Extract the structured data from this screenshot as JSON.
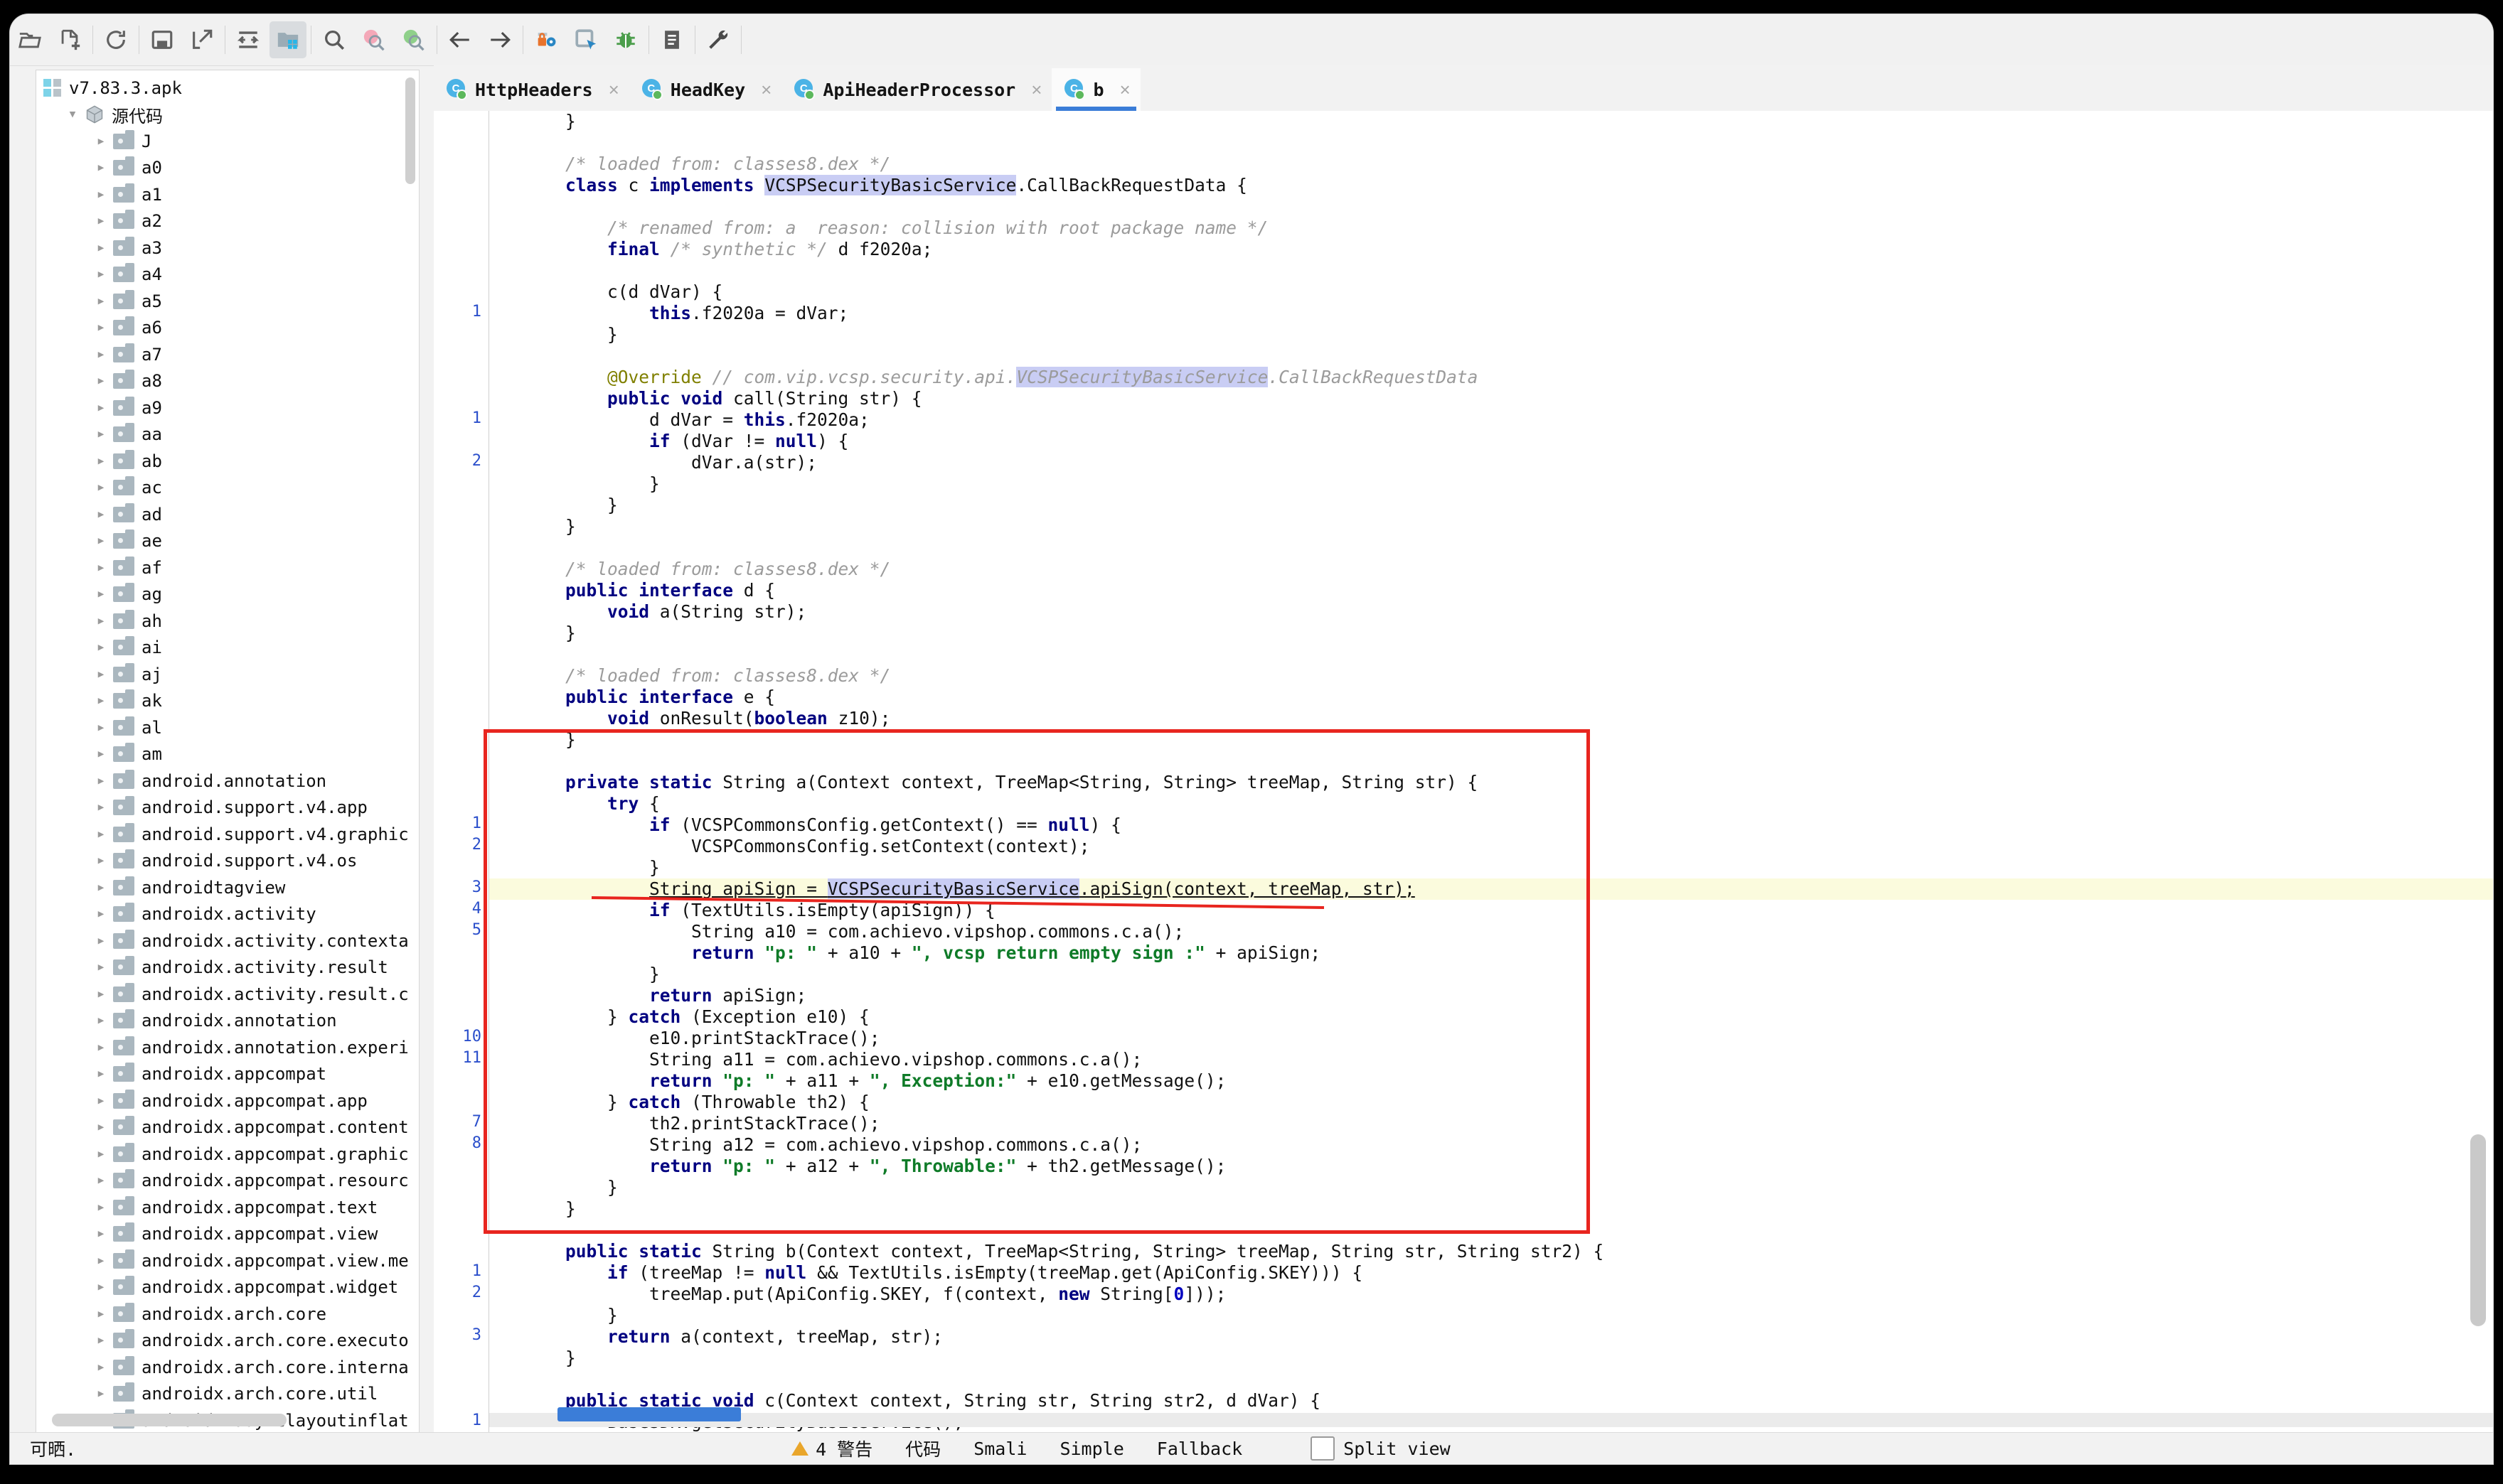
{
  "window": {
    "title": "v7.83.3.apk"
  },
  "toolbar": {
    "buttons": [
      {
        "name": "open-folder-icon",
        "label": "打开"
      },
      {
        "name": "add-file-icon",
        "label": "添加"
      },
      {
        "name": "refresh-icon",
        "label": "刷新"
      },
      {
        "name": "save-icon",
        "label": "保存"
      },
      {
        "name": "export-icon",
        "label": "导出"
      },
      {
        "name": "collapse-icon",
        "label": "折叠"
      },
      {
        "name": "folder-grid-icon",
        "label": "资源"
      },
      {
        "name": "search-icon",
        "label": "搜索"
      },
      {
        "name": "search-prev-icon",
        "label": "上一个"
      },
      {
        "name": "search-next-icon",
        "label": "下一个"
      },
      {
        "name": "back-arrow-icon",
        "label": "后退"
      },
      {
        "name": "forward-arrow-icon",
        "label": "前进"
      },
      {
        "name": "lock-gear-icon",
        "label": "签名"
      },
      {
        "name": "window-pointer-icon",
        "label": "窗口"
      },
      {
        "name": "bug-icon",
        "label": "调试"
      },
      {
        "name": "log-icon",
        "label": "日志"
      },
      {
        "name": "wrench-icon",
        "label": "工具"
      }
    ]
  },
  "tabs": [
    {
      "label": "HttpHeaders",
      "icon": "java-class-icon",
      "close": "×",
      "selected": false
    },
    {
      "label": "HeadKey",
      "icon": "java-class-icon",
      "close": "×",
      "selected": false
    },
    {
      "label": "ApiHeaderProcessor",
      "icon": "java-class-icon",
      "close": "×",
      "selected": false
    },
    {
      "label": "b",
      "icon": "java-class-icon",
      "close": "×",
      "selected": true
    }
  ],
  "sidebar": {
    "root": {
      "label": "v7.83.3.apk",
      "icon": "apk-icon"
    },
    "source_node": {
      "label": "源代码",
      "icon": "package-cube-icon",
      "expanded": true
    },
    "items": [
      "J",
      "a0",
      "a1",
      "a2",
      "a3",
      "a4",
      "a5",
      "a6",
      "a7",
      "a8",
      "a9",
      "aa",
      "ab",
      "ac",
      "ad",
      "ae",
      "af",
      "ag",
      "ah",
      "ai",
      "aj",
      "ak",
      "al",
      "am",
      "android.annotation",
      "android.support.v4.app",
      "android.support.v4.graphic",
      "android.support.v4.os",
      "androidtagview",
      "androidx.activity",
      "androidx.activity.contexta",
      "androidx.activity.result",
      "androidx.activity.result.c",
      "androidx.annotation",
      "androidx.annotation.experi",
      "androidx.appcompat",
      "androidx.appcompat.app",
      "androidx.appcompat.content",
      "androidx.appcompat.graphic",
      "androidx.appcompat.resourc",
      "androidx.appcompat.text",
      "androidx.appcompat.view",
      "androidx.appcompat.view.me",
      "androidx.appcompat.widget",
      "androidx.arch.core",
      "androidx.arch.core.executo",
      "androidx.arch.core.interna",
      "androidx.arch.core.util",
      "androidx.asynclayoutinflat"
    ]
  },
  "editor": {
    "lines": [
      {
        "gutter": "",
        "html": "    }"
      },
      {
        "gutter": "",
        "html": ""
      },
      {
        "gutter": "",
        "html": "    <span class='cm'>/* loaded from: classes8.dex */</span>"
      },
      {
        "gutter": "",
        "html": "    <span class='kw'>class</span> c <span class='kw'>implements</span> <span class='sel'>VCSPSecurityBasicService</span>.CallBackRequestData {"
      },
      {
        "gutter": "",
        "html": ""
      },
      {
        "gutter": "",
        "html": "        <span class='cm'>/* renamed from: a  reason: collision with root package name */</span>"
      },
      {
        "gutter": "",
        "html": "        <span class='kw'>final</span> <span class='cm'>/* synthetic */</span> d f2020a;"
      },
      {
        "gutter": "",
        "html": ""
      },
      {
        "gutter": "",
        "html": "        c(d dVar) {"
      },
      {
        "gutter": "1",
        "html": "            <span class='kw'>this</span>.f2020a = dVar;"
      },
      {
        "gutter": "",
        "html": "        }"
      },
      {
        "gutter": "",
        "html": ""
      },
      {
        "gutter": "",
        "html": "        <span class='an'>@Override</span> <span class='cm'>// com.vip.vcsp.security.api.</span><span class='sel cm'>VCSPSecurityBasicService</span><span class='cm'>.CallBackRequestData</span>"
      },
      {
        "gutter": "",
        "html": "        <span class='kw'>public void</span> call(String str) {"
      },
      {
        "gutter": "1",
        "html": "            d dVar = <span class='kw'>this</span>.f2020a;"
      },
      {
        "gutter": "",
        "html": "            <span class='kw'>if</span> (dVar != <span class='kw'>null</span>) {"
      },
      {
        "gutter": "2",
        "html": "                dVar.a(str);"
      },
      {
        "gutter": "",
        "html": "            }"
      },
      {
        "gutter": "",
        "html": "        }"
      },
      {
        "gutter": "",
        "html": "    }"
      },
      {
        "gutter": "",
        "html": ""
      },
      {
        "gutter": "",
        "html": "    <span class='cm'>/* loaded from: classes8.dex */</span>"
      },
      {
        "gutter": "",
        "html": "    <span class='kw'>public interface</span> d {"
      },
      {
        "gutter": "",
        "html": "        <span class='kw'>void</span> a(String str);"
      },
      {
        "gutter": "",
        "html": "    }"
      },
      {
        "gutter": "",
        "html": ""
      },
      {
        "gutter": "",
        "html": "    <span class='cm'>/* loaded from: classes8.dex */</span>"
      },
      {
        "gutter": "",
        "html": "    <span class='kw'>public interface</span> e {"
      },
      {
        "gutter": "",
        "html": "        <span class='kw'>void</span> onResult(<span class='kw'>boolean</span> z10);"
      },
      {
        "gutter": "",
        "html": "    }"
      },
      {
        "gutter": "",
        "html": ""
      },
      {
        "gutter": "",
        "html": "    <span class='kw'>private static</span> String a(Context context, TreeMap&lt;String, String&gt; treeMap, String str) {"
      },
      {
        "gutter": "",
        "html": "        <span class='kw'>try</span> {"
      },
      {
        "gutter": "1",
        "html": "            <span class='kw'>if</span> (VCSPCommonsConfig.getContext() == <span class='kw'>null</span>) {"
      },
      {
        "gutter": "2",
        "html": "                VCSPCommonsConfig.setContext(context);"
      },
      {
        "gutter": "",
        "html": "            }"
      },
      {
        "gutter": "3",
        "hl": true,
        "html": "            <span class='und'>String apiSign = </span><span class='sel und'>VCSPSecurityBasicService</span><span class='und'>.apiSign(context, treeMap, str);</span>"
      },
      {
        "gutter": "4",
        "html": "            <span class='kw'>if</span> (TextUtils.isEmpty(apiSign)) {"
      },
      {
        "gutter": "5",
        "html": "                String a10 = com.achievo.vipshop.commons.c.a();"
      },
      {
        "gutter": "",
        "html": "                <span class='kw'>return</span> <span class='st'>\"p: \"</span> + a10 + <span class='st'>\", vcsp return empty sign :\"</span> + apiSign;"
      },
      {
        "gutter": "",
        "html": "            }"
      },
      {
        "gutter": "",
        "html": "            <span class='kw'>return</span> apiSign;"
      },
      {
        "gutter": "",
        "html": "        } <span class='kw'>catch</span> (Exception e10) {"
      },
      {
        "gutter": "10",
        "html": "            e10.printStackTrace();"
      },
      {
        "gutter": "11",
        "html": "            String a11 = com.achievo.vipshop.commons.c.a();"
      },
      {
        "gutter": "",
        "html": "            <span class='kw'>return</span> <span class='st'>\"p: \"</span> + a11 + <span class='st'>\", Exception:\"</span> + e10.getMessage();"
      },
      {
        "gutter": "",
        "html": "        } <span class='kw'>catch</span> (Throwable th2) {"
      },
      {
        "gutter": "7",
        "html": "            th2.printStackTrace();"
      },
      {
        "gutter": "8",
        "html": "            String a12 = com.achievo.vipshop.commons.c.a();"
      },
      {
        "gutter": "",
        "html": "            <span class='kw'>return</span> <span class='st'>\"p: \"</span> + a12 + <span class='st'>\", Throwable:\"</span> + th2.getMessage();"
      },
      {
        "gutter": "",
        "html": "        }"
      },
      {
        "gutter": "",
        "html": "    }"
      },
      {
        "gutter": "",
        "html": ""
      },
      {
        "gutter": "",
        "html": "    <span class='kw'>public static</span> String b(Context context, TreeMap&lt;String, String&gt; treeMap, String str, String str2) {"
      },
      {
        "gutter": "1",
        "html": "        <span class='kw'>if</span> (treeMap != <span class='kw'>null</span> &amp;&amp; TextUtils.isEmpty(treeMap.get(ApiConfig.SKEY))) {"
      },
      {
        "gutter": "2",
        "html": "            treeMap.put(ApiConfig.SKEY, f(context, <span class='kw'>new</span> String[<span class='nm'>0</span>]));"
      },
      {
        "gutter": "",
        "html": "        }"
      },
      {
        "gutter": "3",
        "html": "        <span class='kw'>return</span> a(context, treeMap, str);"
      },
      {
        "gutter": "",
        "html": "    }"
      },
      {
        "gutter": "",
        "html": ""
      },
      {
        "gutter": "",
        "html": "    <span class='kw'>public static void</span> c(Context context, String str, String str2, d dVar) {"
      },
      {
        "gutter": "1",
        "html": "        BaseSDK.getSecurityBasicService();"
      }
    ]
  },
  "statusbar": {
    "left_text": "可晒.",
    "warnings": "4 警告",
    "modes": [
      "代码",
      "Smali",
      "Simple",
      "Fallback"
    ],
    "split_view": "Split view"
  }
}
